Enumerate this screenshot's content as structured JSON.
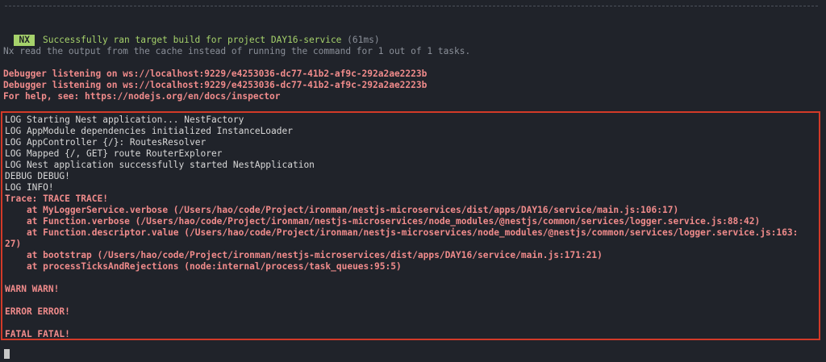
{
  "terminal": {
    "nx_badge": "NX",
    "nx_message": "Successfully ran target build for project DAY16-service",
    "nx_duration": "(61ms)",
    "cache_message": "Nx read the output from the cache instead of running the command for 1 out of 1 tasks.",
    "debugger_lines": [
      "Debugger listening on ws://localhost:9229/e4253036-dc77-41b2-af9c-292a2ae2223b",
      "Debugger listening on ws://localhost:9229/e4253036-dc77-41b2-af9c-292a2ae2223b",
      "For help, see: https://nodejs.org/en/docs/inspector"
    ],
    "log_lines": [
      "LOG Starting Nest application... NestFactory",
      "LOG AppModule dependencies initialized InstanceLoader",
      "LOG AppController {/}: RoutesResolver",
      "LOG Mapped {/, GET} route RouterExplorer",
      "LOG Nest application successfully started NestApplication",
      "DEBUG DEBUG!",
      "LOG INFO!"
    ],
    "trace_lines": [
      "Trace: TRACE TRACE!",
      "    at MyLoggerService.verbose (/Users/hao/code/Project/ironman/nestjs-microservices/dist/apps/DAY16/service/main.js:106:17)",
      "    at Function.verbose (/Users/hao/code/Project/ironman/nestjs-microservices/node_modules/@nestjs/common/services/logger.service.js:88:42)",
      "    at Function.descriptor.value (/Users/hao/code/Project/ironman/nestjs-microservices/node_modules/@nestjs/common/services/logger.service.js:163:",
      "27)",
      "    at bootstrap (/Users/hao/code/Project/ironman/nestjs-microservices/dist/apps/DAY16/service/main.js:171:21)",
      "    at processTicksAndRejections (node:internal/process/task_queues:95:5)"
    ],
    "warn_line": "WARN WARN!",
    "error_line": "ERROR ERROR!",
    "fatal_line": "FATAL FATAL!"
  }
}
